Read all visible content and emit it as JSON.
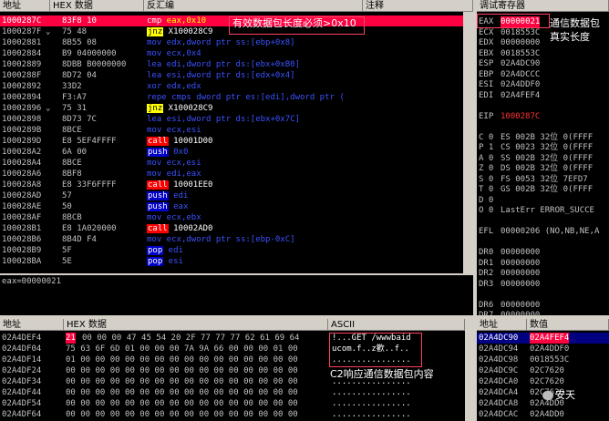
{
  "disasm": {
    "headers": {
      "addr": "地址",
      "hex": "HEX 数据",
      "asm": "反汇编",
      "comment": "注释"
    },
    "rows": [
      {
        "addr": "1000287C",
        "hex": "83F8 10",
        "asm": "cmp eax,0x10",
        "selected": true
      },
      {
        "addr": "1000287F",
        "hex": "75 48",
        "asm": "jnz X100028C9",
        "mark": "⌄",
        "jump": true
      },
      {
        "addr": "10002881",
        "hex": "8B55 08",
        "asm": "mov edx,dword ptr ss:[ebp+0x8]"
      },
      {
        "addr": "10002884",
        "hex": "B9 04000000",
        "asm": "mov ecx,0x4"
      },
      {
        "addr": "10002889",
        "hex": "8DBB B0000000",
        "asm": "lea edi,dword ptr ds:[ebx+0xB0]"
      },
      {
        "addr": "1000288F",
        "hex": "8D72 04",
        "asm": "lea esi,dword ptr ds:[edx+0x4]"
      },
      {
        "addr": "10002892",
        "hex": "33D2",
        "asm": "xor edx,edx"
      },
      {
        "addr": "10002894",
        "hex": "F3:A7",
        "asm": "repe cmps dword ptr es:[edi],dword ptr ("
      },
      {
        "addr": "10002896",
        "hex": "75 31",
        "asm": "jnz X100028C9",
        "mark": "⌄",
        "jump": true
      },
      {
        "addr": "10002898",
        "hex": "8D73 7C",
        "asm": "lea esi,dword ptr ds:[ebx+0x7C]"
      },
      {
        "addr": "1000289B",
        "hex": "8BCE",
        "asm": "mov ecx,esi"
      },
      {
        "addr": "1000289D",
        "hex": "E8 5EF4FFFF",
        "asm": "call 10001D00",
        "call": true
      },
      {
        "addr": "100028A2",
        "hex": "6A 00",
        "asm": "push 0x0",
        "push": true
      },
      {
        "addr": "100028A4",
        "hex": "8BCE",
        "asm": "mov ecx,esi"
      },
      {
        "addr": "100028A6",
        "hex": "8BF8",
        "asm": "mov edi,eax"
      },
      {
        "addr": "100028A8",
        "hex": "E8 33F6FFFF",
        "asm": "call 10001EE0",
        "call": true
      },
      {
        "addr": "100028AD",
        "hex": "57",
        "asm": "push edi",
        "push": true
      },
      {
        "addr": "100028AE",
        "hex": "50",
        "asm": "push eax",
        "push": true
      },
      {
        "addr": "100028AF",
        "hex": "8BCB",
        "asm": "mov ecx,ebx"
      },
      {
        "addr": "100028B1",
        "hex": "E8 1A020000",
        "asm": "call 10002AD0",
        "call": true
      },
      {
        "addr": "100028B6",
        "hex": "8B4D F4",
        "asm": "mov ecx,dword ptr ss:[ebp-0xC]"
      },
      {
        "addr": "100028B9",
        "hex": "5F",
        "asm": "pop edi",
        "push": true
      },
      {
        "addr": "100028BA",
        "hex": "5E",
        "asm": "pop esi",
        "push": true
      }
    ],
    "annotation": "有效数据包长度必须>0x10",
    "info_line": "eax=00000021"
  },
  "registers": {
    "header": "调试寄存器",
    "annotation_line1": "通信数据包",
    "annotation_line2": "真实长度",
    "lines": [
      {
        "name": "EAX",
        "value": "00000021",
        "highlight": true
      },
      {
        "name": "ECX",
        "value": "0018553C"
      },
      {
        "name": "EDX",
        "value": "00000000"
      },
      {
        "name": "EBX",
        "value": "0018553C"
      },
      {
        "name": "ESP",
        "value": "02A4DC90"
      },
      {
        "name": "EBP",
        "value": "02A4DCCC"
      },
      {
        "name": "ESI",
        "value": "02A4DDF0"
      },
      {
        "name": "EDI",
        "value": "02A4FEF4"
      },
      {
        "name": "",
        "value": ""
      },
      {
        "name": "EIP",
        "value": "1000287C",
        "red": true
      },
      {
        "name": "",
        "value": ""
      },
      {
        "name": "C 0",
        "value": "ES 002B 32位 0(FFFF"
      },
      {
        "name": "P 1",
        "value": "CS 0023 32位 0(FFFF"
      },
      {
        "name": "A 0",
        "value": "SS 002B 32位 0(FFFF"
      },
      {
        "name": "Z 0",
        "value": "DS 002B 32位 0(FFFF"
      },
      {
        "name": "S 0",
        "value": "FS 0053 32位 7EFD7"
      },
      {
        "name": "T 0",
        "value": "GS 002B 32位 0(FFFF"
      },
      {
        "name": "D 0",
        "value": ""
      },
      {
        "name": "O 0",
        "value": "LastErr ERROR_SUCCE"
      },
      {
        "name": "",
        "value": ""
      },
      {
        "name": "EFL",
        "value": "00000206 (NO,NB,NE,A"
      },
      {
        "name": "",
        "value": ""
      },
      {
        "name": "DR0",
        "value": "00000000"
      },
      {
        "name": "DR1",
        "value": "00000000"
      },
      {
        "name": "DR2",
        "value": "00000000"
      },
      {
        "name": "DR3",
        "value": "00000000"
      },
      {
        "name": "",
        "value": ""
      },
      {
        "name": "DR6",
        "value": "00000000"
      },
      {
        "name": "DR7",
        "value": "00000000"
      }
    ]
  },
  "dump": {
    "headers": {
      "addr": "地址",
      "hex": "HEX 数据",
      "ascii": "ASCII"
    },
    "rows": [
      {
        "addr": "02A4DEF4",
        "first": "21",
        "hex": "00 00 00 47 45 54 20 2F 77 77 77 62 61 69 64",
        "ascii": "!...GET /wwwbaid"
      },
      {
        "addr": "02A4DF04",
        "hex": "75 63 6F 6D 01 00 00 00 7A 9A 66 00 00 00 01 00",
        "ascii": "ucom.f..z歡..f.."
      },
      {
        "addr": "02A4DF14",
        "hex": "01 00 00 00 00 00 00 00 00 00 00 00 00 00 00 00",
        "ascii": "................"
      },
      {
        "addr": "02A4DF24",
        "hex": "00 00 00 00 00 00 00 00 00 00 00 00 00 00 00 00",
        "ascii": ""
      },
      {
        "addr": "02A4DF34",
        "hex": "00 00 00 00 00 00 00 00 00 00 00 00 00 00 00 00",
        "ascii": "................"
      },
      {
        "addr": "02A4DF44",
        "hex": "00 00 00 00 00 00 00 00 00 00 00 00 00 00 00 00",
        "ascii": "................"
      },
      {
        "addr": "02A4DF54",
        "hex": "00 00 00 00 00 00 00 00 00 00 00 00 00 00 00 00",
        "ascii": "................"
      },
      {
        "addr": "02A4DF64",
        "hex": "00 00 00 00 00 00 00 00 00 00 00 00 00 00 00 00",
        "ascii": "................"
      }
    ],
    "annotation": "C2响应通信数据包内容"
  },
  "stack": {
    "headers": {
      "addr": "地址",
      "value": "数值"
    },
    "rows": [
      {
        "addr": "02A4DC90",
        "value": "02A4FEF4",
        "selected": true
      },
      {
        "addr": "02A4DC94",
        "value": "02A4DDF0"
      },
      {
        "addr": "02A4DC98",
        "value": "0018553C"
      },
      {
        "addr": "02A4DC9C",
        "value": "02C7620"
      },
      {
        "addr": "02A4DCA0",
        "value": "02C7620"
      },
      {
        "addr": "02A4DCA4",
        "value": "02C7620"
      },
      {
        "addr": "02A4DCA8",
        "value": "02A4DD0"
      },
      {
        "addr": "02A4DCAC",
        "value": "02A4DD0"
      }
    ],
    "watermark": "安天"
  }
}
